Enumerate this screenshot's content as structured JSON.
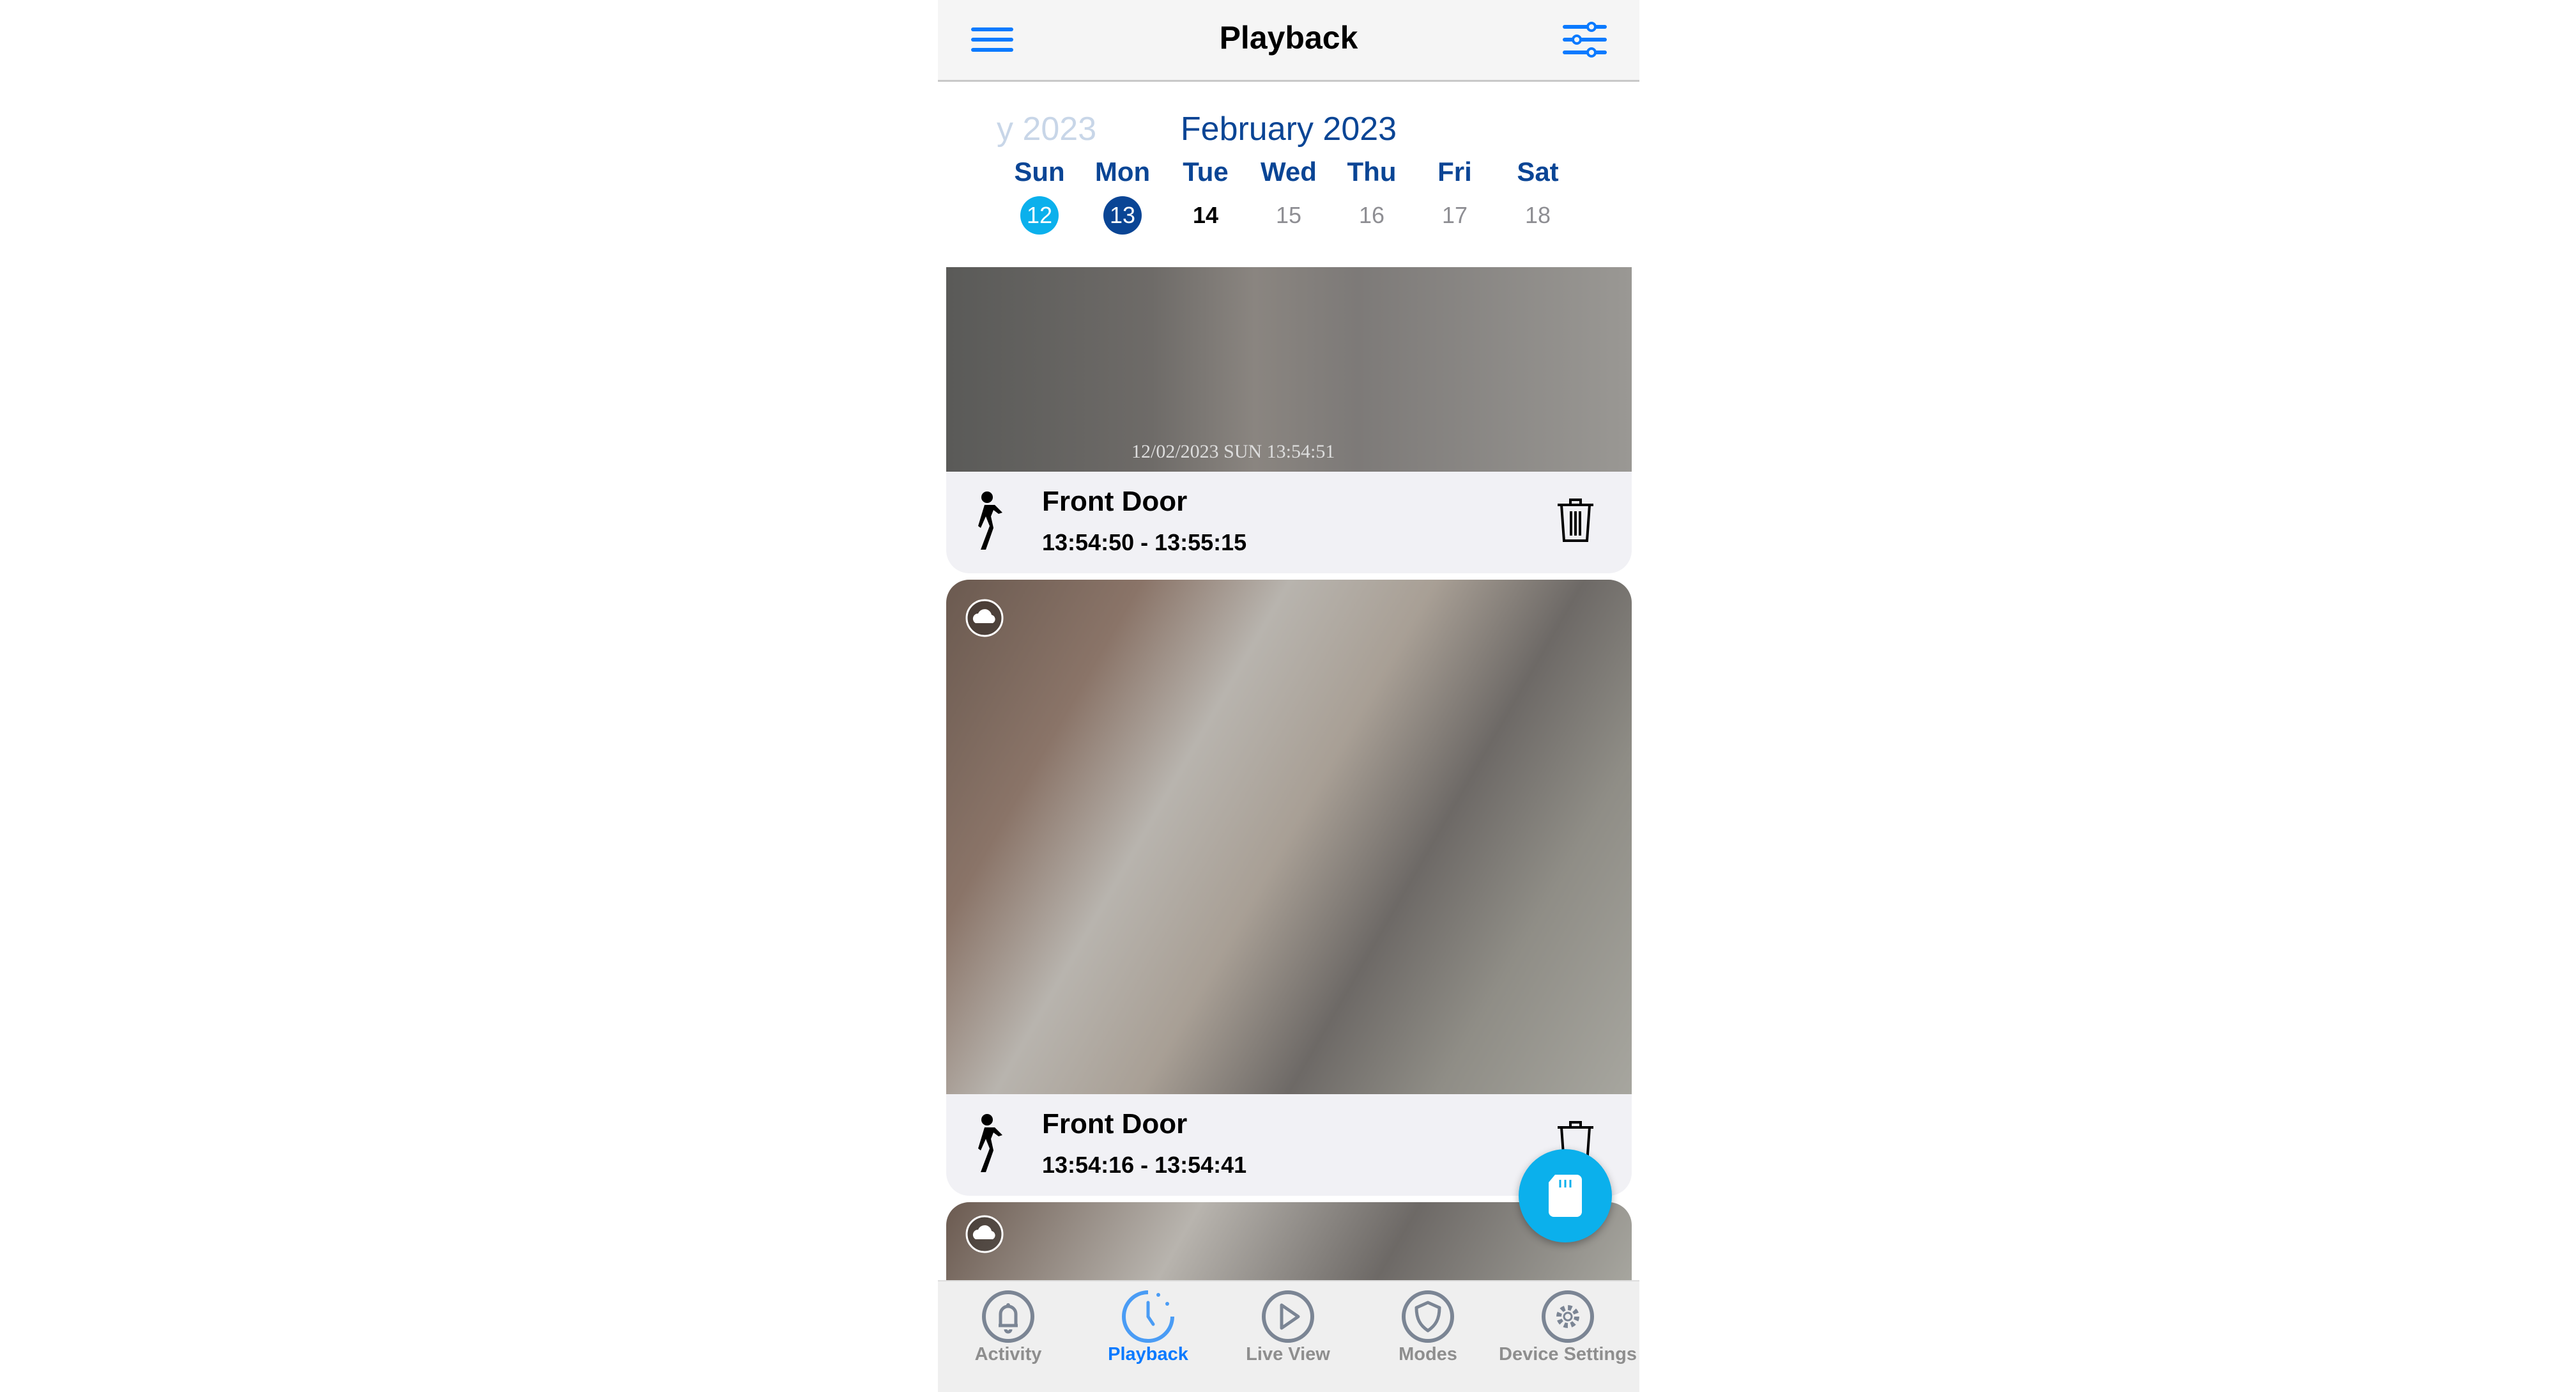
{
  "header": {
    "title": "Playback",
    "menu_icon": "hamburger-icon",
    "filter_icon": "sliders-icon"
  },
  "calendar": {
    "prev_month": "y 2023",
    "current_month": "February 2023",
    "days": [
      {
        "name": "Sun",
        "date": "12",
        "state": "has-recordings"
      },
      {
        "name": "Mon",
        "date": "13",
        "state": "selected"
      },
      {
        "name": "Tue",
        "date": "14",
        "state": "today"
      },
      {
        "name": "Wed",
        "date": "15"
      },
      {
        "name": "Thu",
        "date": "16"
      },
      {
        "name": "Fri",
        "date": "17"
      },
      {
        "name": "Sat",
        "date": "18"
      }
    ]
  },
  "recordings": [
    {
      "camera": "Front Door",
      "time": "13:54:50 - 13:55:15",
      "overlay": "12/02/2023 SUN 13:54:51"
    },
    {
      "camera": "Front Door",
      "time": "13:54:16 - 13:54:41"
    }
  ],
  "tabs": [
    {
      "label": "Activity",
      "icon": "bell-icon"
    },
    {
      "label": "Playback",
      "icon": "clock-icon",
      "active": true
    },
    {
      "label": "Live View",
      "icon": "play-icon"
    },
    {
      "label": "Modes",
      "icon": "shield-icon"
    },
    {
      "label": "Device Settings",
      "icon": "gear-icon"
    }
  ],
  "colors": {
    "accent": "#0a7aff",
    "navy": "#0a4595",
    "cyan": "#0bb0ec"
  }
}
